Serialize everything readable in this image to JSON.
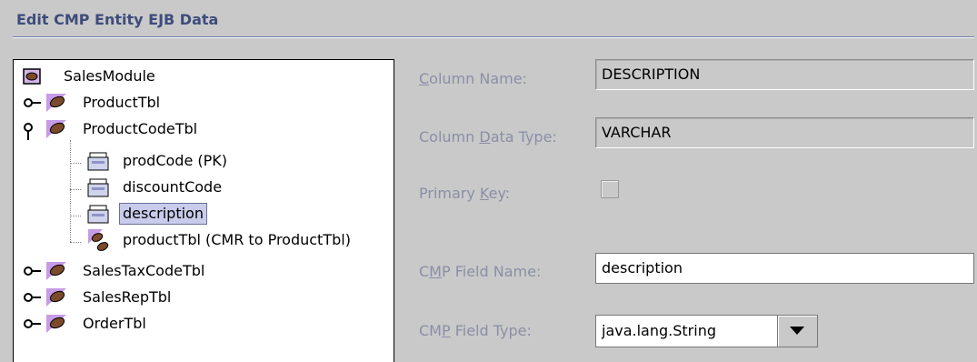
{
  "panel": {
    "title": "Edit CMP Entity EJB Data"
  },
  "tree": {
    "root": {
      "label": "SalesModule",
      "icon": "module-icon"
    },
    "nodes": [
      {
        "label": "ProductTbl",
        "icon": "bean-icon",
        "expander": "collapsed",
        "selected": false
      },
      {
        "label": "ProductCodeTbl",
        "icon": "bean-icon",
        "expander": "expanded",
        "selected": false,
        "children": [
          {
            "label": "prodCode (PK)",
            "icon": "field-icon",
            "selected": false
          },
          {
            "label": "discountCode",
            "icon": "field-icon",
            "selected": false
          },
          {
            "label": "description",
            "icon": "field-icon",
            "selected": true
          },
          {
            "label": "productTbl (CMR to ProductTbl)",
            "icon": "relationship-icon",
            "selected": false
          }
        ]
      },
      {
        "label": "SalesTaxCodeTbl",
        "icon": "bean-icon",
        "expander": "collapsed",
        "selected": false
      },
      {
        "label": "SalesRepTbl",
        "icon": "bean-icon",
        "expander": "collapsed",
        "selected": false
      },
      {
        "label": "OrderTbl",
        "icon": "bean-icon",
        "expander": "collapsed",
        "selected": false
      }
    ]
  },
  "form": {
    "column_name": {
      "label_pre": "",
      "mnemonic": "C",
      "label_post": "olumn Name:",
      "value": "DESCRIPTION"
    },
    "column_data_type": {
      "label_pre": "Column ",
      "mnemonic": "D",
      "label_post": "ata Type:",
      "value": "VARCHAR"
    },
    "primary_key": {
      "label_pre": "Primary ",
      "mnemonic": "K",
      "label_post": "ey:",
      "checked": false
    },
    "cmp_field_name": {
      "label_pre": "C",
      "mnemonic": "M",
      "label_post": "P Field Name:",
      "value": "description"
    },
    "cmp_field_type": {
      "label_pre": "CM",
      "mnemonic": "P",
      "label_post": " Field Type:",
      "value": "java.lang.String"
    }
  },
  "colors": {
    "background": "#c9c9c9",
    "title": "#3d4c7c",
    "label": "#8a8fa6",
    "selection": "#c9cbea"
  }
}
